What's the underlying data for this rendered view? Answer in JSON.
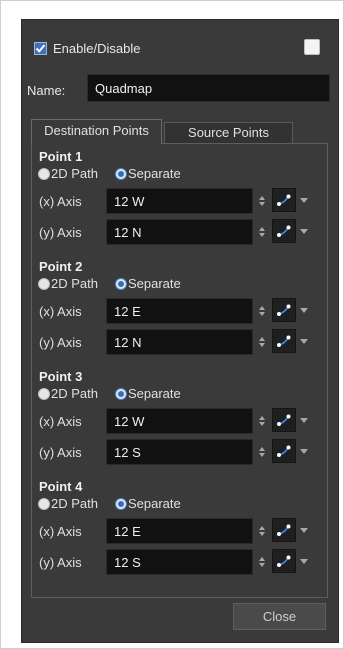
{
  "enable": {
    "label": "Enable/Disable",
    "checked": true
  },
  "name": {
    "label": "Name:",
    "value": "Quadmap"
  },
  "tabs": [
    {
      "label": "Destination Points",
      "active": true
    },
    {
      "label": "Source Points",
      "active": false
    }
  ],
  "radio": {
    "path_label": "2D Path",
    "separate_label": "Separate",
    "selected": "Separate"
  },
  "axis_labels": {
    "x": "(x) Axis",
    "y": "(y) Axis"
  },
  "points": [
    {
      "title": "Point 1",
      "x": "12 W",
      "y": "12 N"
    },
    {
      "title": "Point 2",
      "x": "12 E",
      "y": "12 N"
    },
    {
      "title": "Point 3",
      "x": "12 W",
      "y": "12 S"
    },
    {
      "title": "Point 4",
      "x": "12 E",
      "y": "12 S"
    }
  ],
  "close_label": "Close",
  "colors": {
    "dialog_bg": "#3a3a3a",
    "input_bg": "#111111",
    "accent": "#3f6fb6"
  }
}
